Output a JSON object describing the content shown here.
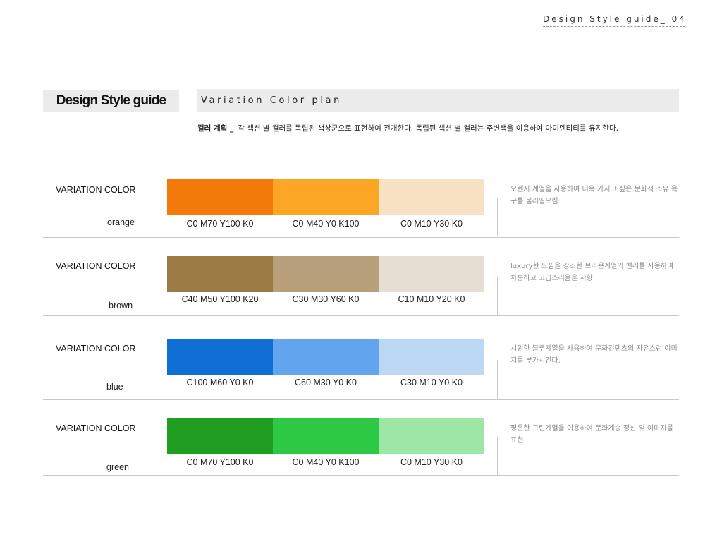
{
  "header": {
    "text": "Design Style guide_ 04"
  },
  "title": "Design Style guide",
  "subtitle": "Variation Color plan",
  "plan_note": {
    "label": "컬러 계획 _",
    "text": "각 섹션 별 컬러를 독립된 색상군으로 표현하여 전개한다. 독립된 섹션 별 컬러는 주변색을 이용하여 아이덴티티를 유지한다."
  },
  "sections": [
    {
      "label": "VARIATION  COLOR",
      "name": "orange",
      "swatches": [
        {
          "color": "#f27a0a",
          "code": "C0 M70 Y100 K0"
        },
        {
          "color": "#fca625",
          "code": "C0 M40 Y0 K100"
        },
        {
          "color": "#f8e2c3",
          "code": "C0 M10 Y30 K0"
        }
      ],
      "description": "오렌지 계열을 사용하여 더욱 가지고 싶은 문화적 소유 욕구를 불러일으킴"
    },
    {
      "label": "VARIATION  COLOR",
      "name": "brown",
      "swatches": [
        {
          "color": "#9b7a44",
          "code": "C40 M50 Y100 K20"
        },
        {
          "color": "#b8a07a",
          "code": "C30 M30 Y60 K0"
        },
        {
          "color": "#e6ded1",
          "code": "C10 M10 Y20 K0"
        }
      ],
      "description": "luxury한 느낌을 강조한 브라운계열의 컬러를 사용하여 차분하고 고급스러움을 지향"
    },
    {
      "label": "VARIATION  COLOR",
      "name": "blue",
      "swatches": [
        {
          "color": "#0f6fd4",
          "code": "C100 M60 Y0 K0"
        },
        {
          "color": "#62a5ee",
          "code": "C60 M30 Y0 K0"
        },
        {
          "color": "#bcd8f5",
          "code": "C30 M10 Y0 K0"
        }
      ],
      "description": "시원한 블루계열을 사용하여 문화컨텐츠의 자유스런 이미지를 부가시킨다."
    },
    {
      "label": "VARIATION  COLOR",
      "name": "green",
      "swatches": [
        {
          "color": "#1f9e22",
          "code": "C0 M70 Y100 K0"
        },
        {
          "color": "#2ec944",
          "code": "C0 M40 Y0 K100"
        },
        {
          "color": "#9ee6a6",
          "code": "C0 M10 Y30 K0"
        }
      ],
      "description": "평온한 그린계열을 이용하여 문화계승 정신 및 이미지를 표현"
    }
  ]
}
